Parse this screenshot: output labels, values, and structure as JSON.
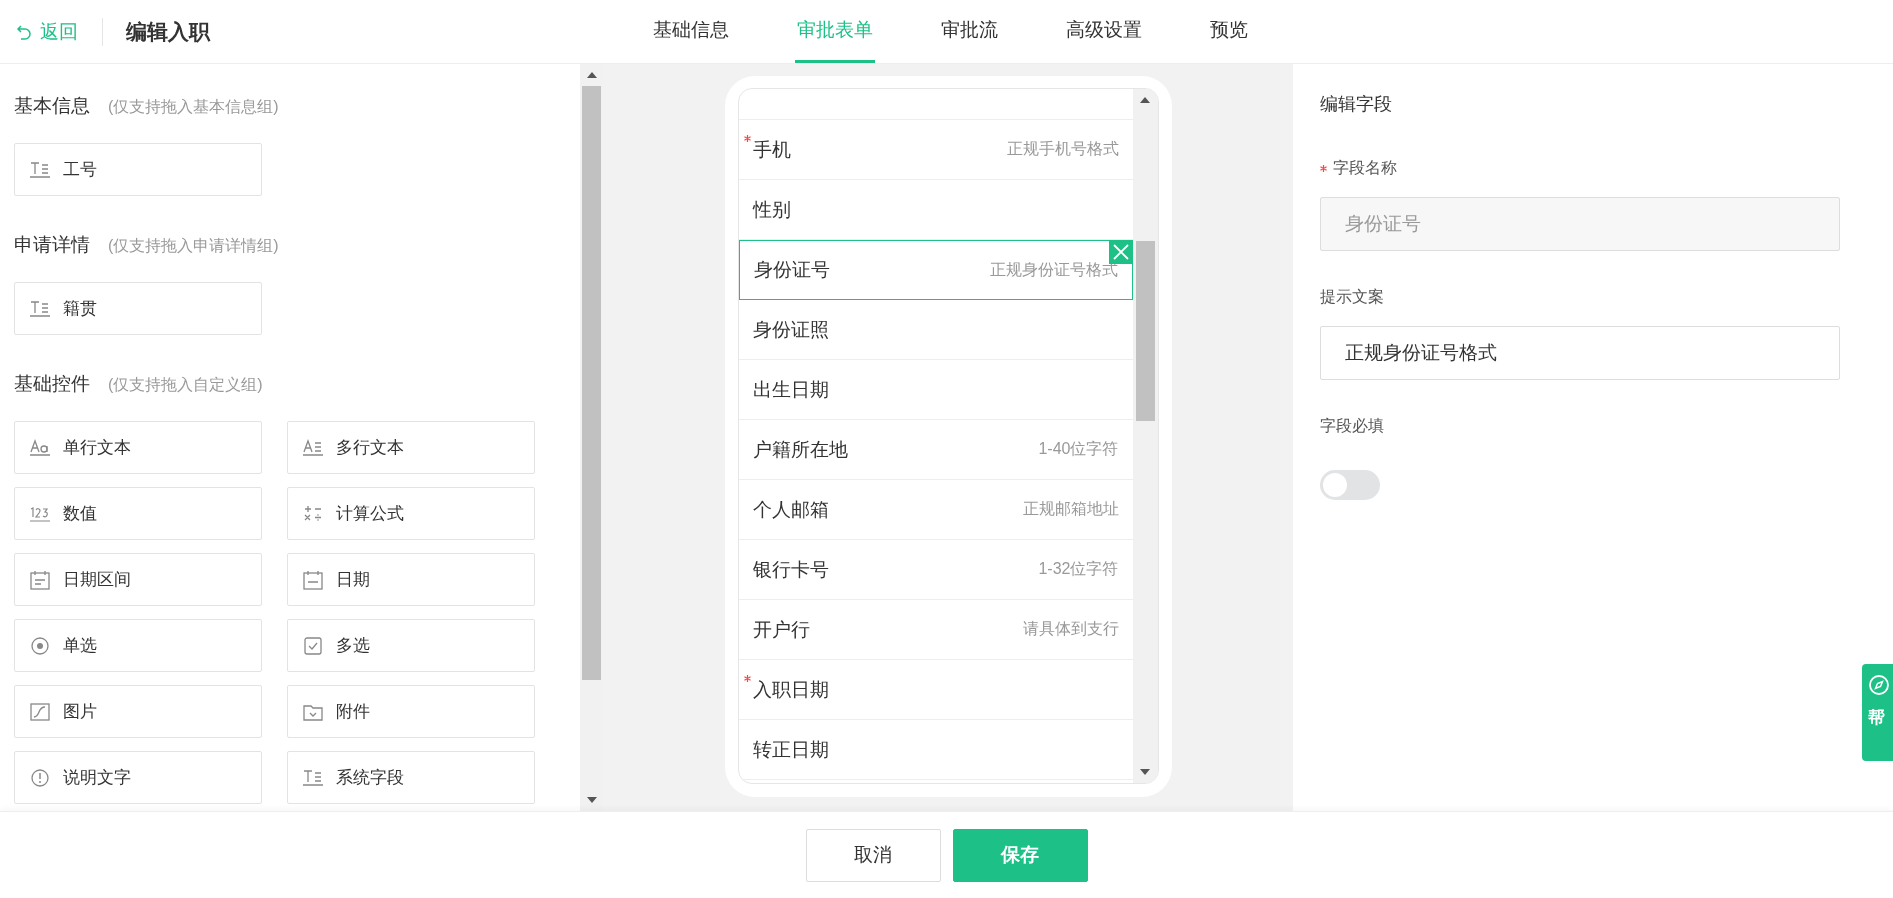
{
  "header": {
    "back": "返回",
    "title": "编辑入职",
    "tabs": [
      {
        "label": "基础信息",
        "selected": false
      },
      {
        "label": "审批表单",
        "selected": true
      },
      {
        "label": "审批流",
        "selected": false
      },
      {
        "label": "高级设置",
        "selected": false
      },
      {
        "label": "预览",
        "selected": false
      }
    ]
  },
  "palette": {
    "groups": [
      {
        "title": "基本信息",
        "hint": "(仅支持拖入基本信息组)",
        "items": [
          {
            "label": "工号",
            "kind": "system"
          }
        ]
      },
      {
        "title": "申请详情",
        "hint": "(仅支持拖入申请详情组)",
        "items": [
          {
            "label": "籍贯",
            "kind": "system"
          }
        ]
      },
      {
        "title": "基础控件",
        "hint": "(仅支持拖入自定义组)",
        "items": [
          {
            "label": "单行文本",
            "kind": "single-line"
          },
          {
            "label": "多行文本",
            "kind": "multi-line"
          },
          {
            "label": "数值",
            "kind": "number"
          },
          {
            "label": "计算公式",
            "kind": "formula"
          },
          {
            "label": "日期区间",
            "kind": "date-range"
          },
          {
            "label": "日期",
            "kind": "date"
          },
          {
            "label": "单选",
            "kind": "radio"
          },
          {
            "label": "多选",
            "kind": "checkbox"
          },
          {
            "label": "图片",
            "kind": "image"
          },
          {
            "label": "附件",
            "kind": "attachment"
          },
          {
            "label": "说明文字",
            "kind": "info"
          },
          {
            "label": "系统字段",
            "kind": "system"
          }
        ]
      }
    ]
  },
  "form_preview": {
    "fields": [
      {
        "label": "手机",
        "hint": "正规手机号格式",
        "required": true,
        "selected": false
      },
      {
        "label": "性别",
        "required": false,
        "selected": false
      },
      {
        "label": "身份证号",
        "hint": "正规身份证号格式",
        "required": false,
        "selected": true
      },
      {
        "label": "身份证照",
        "required": false,
        "selected": false
      },
      {
        "label": "出生日期",
        "required": false,
        "selected": false
      },
      {
        "label": "户籍所在地",
        "hint": "1-40位字符",
        "required": false,
        "selected": false
      },
      {
        "label": "个人邮箱",
        "hint": "正规邮箱地址",
        "required": false,
        "selected": false
      },
      {
        "label": "银行卡号",
        "hint": "1-32位字符",
        "required": false,
        "selected": false
      },
      {
        "label": "开户行",
        "hint": "请具体到支行",
        "required": false,
        "selected": false
      },
      {
        "label": "入职日期",
        "required": true,
        "selected": false
      },
      {
        "label": "转正日期",
        "required": false,
        "selected": false
      }
    ]
  },
  "field_editor": {
    "title": "编辑字段",
    "name_field": {
      "label": "字段名称",
      "required": true,
      "value": "身份证号",
      "disabled": true
    },
    "hint_field": {
      "label": "提示文案",
      "value": "正规身份证号格式"
    },
    "required_label": "字段必填",
    "required_on": false
  },
  "help_tab": {
    "label": "帮"
  },
  "footer": {
    "buttons": [
      {
        "label": "取消",
        "kind": "secondary"
      },
      {
        "label": "保存",
        "kind": "primary"
      }
    ]
  }
}
